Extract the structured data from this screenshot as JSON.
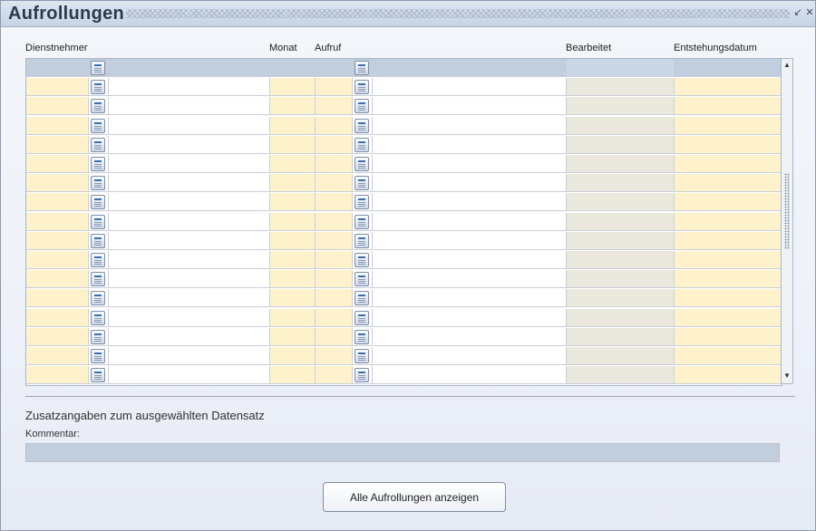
{
  "window": {
    "title": "Aufrollungen"
  },
  "columns": {
    "dienstnehmer": "Dienstnehmer",
    "monat": "Monat",
    "aufruf": "Aufruf",
    "bearbeitet": "Bearbeitet",
    "entstehungsdatum": "Entstehungsdatum"
  },
  "grid": {
    "row_count": 17,
    "selected_row": 0
  },
  "details": {
    "section_title": "Zusatzangaben zum ausgewählten Datensatz",
    "comment_label": "Kommentar:",
    "comment_value": ""
  },
  "actions": {
    "show_all_label": "Alle Aufrollungen anzeigen"
  },
  "colors": {
    "yellow_cell": "#fdf2cc",
    "gray_cell": "#ebe9de",
    "selected_row": "#c1cedd",
    "comment_field": "#c3cedd"
  }
}
